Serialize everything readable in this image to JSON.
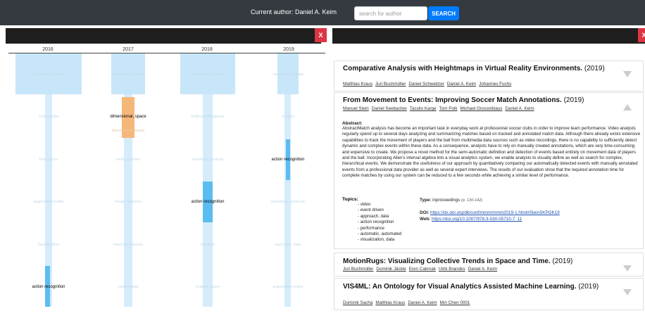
{
  "header": {
    "author_label": "Current author: Daniel A. Keim",
    "search_placeholder": "search for author",
    "search_button": "SEARCH"
  },
  "left_panel": {
    "close_label": "X"
  },
  "right_panel": {
    "close_label": "X"
  },
  "timeline": {
    "years": [
      "2016",
      "2017",
      "2018",
      "2019"
    ],
    "rows": [
      [
        "visualization, data",
        "visualization, data",
        "visualization, data",
        "visualization, data"
      ],
      [
        "multi-modal",
        "dimensional, space",
        "artificial intelligence",
        "models"
      ],
      [
        "time series",
        "entity, entities",
        "sensitivity analysis",
        "action recognition"
      ],
      [
        "augmented reality",
        "image, features",
        "action recognition",
        "animation, synthesis"
      ],
      [
        "classification",
        "machine learning",
        "big data",
        "approach, data"
      ],
      [
        "action recognition",
        "multi-modal",
        "chapter, paper",
        "augmented reality"
      ]
    ],
    "sub_label": "dimensional, space"
  },
  "papers": [
    {
      "title": "Comparative Analysis with Heightmaps in Virtual Reality Environments.",
      "year": "(2019)",
      "authors": [
        "Matthias Kraus",
        "Juri Buchmüller",
        "Daniel Schweitzer",
        "Daniel A. Keim",
        "Johannes Fuchs"
      ]
    },
    {
      "title": "From Movement to Events: Improving Soccer Match Annotations.",
      "year": "(2019)",
      "authors": [
        "Manuel Stein",
        "Daniel Seebacher",
        "Tassilo Karge",
        "Tom Polk",
        "Michael Grossniklaus",
        "Daniel A. Keim"
      ],
      "abstract_label": "Abstract:",
      "abstract": "AbstractMatch analysis has become an important task in everyday work at professional soccer clubs in order to improve team performance. Video analysts regularly spend up to several days analyzing and summarizing matches based on tracked and annotated match data. Although there already exists extensive capabilities to track the movement of players and the ball from multimedia data sources such as video recordings, there is no capability to sufficiently detect dynamic and complex events within these data. As a consequence, analysts have to rely on manually created annotations, which are very time-consuming and expensive to create. We propose a novel method for the semi-automatic definition and detection of events based entirely on movement data of players and the ball. Incorporating Allen's interval algebra into a visual analytics system, we enable analysts to visually define as well as search for complex, hierarchical events. We demonstrate the usefulness of our approach by quantitatively comparing our automatically detected events with manually annotated events from a professional data provider as well as several expert interviews. The results of our evaluation show that the required annotation time for complete matches by using our system can be reduced to a few seconds while achieving a similar level of performance.",
      "topics_label": "Topics:",
      "topics": [
        "- video",
        "- event driven",
        "- approach, data",
        "- action recognition",
        "- performance",
        "- automatic, automated",
        "- visualization, data"
      ],
      "type_label": "Type:",
      "type": "inproceedings",
      "pages": "(p. 130-142)",
      "doi_label": "DOI:",
      "doi": "https://dx.doi.org/db/conf/mmm/mmm2019-1.html#SteinSKPGK19",
      "web_label": "Web:",
      "web": "https://doi.org/10.1007/978-3-030-05710-7_11"
    },
    {
      "title": "MotionRugs: Visualizing Collective Trends in Space and Time.",
      "year": "(2019)",
      "authors": [
        "Juri Buchmüller",
        "Dominik Jäckle",
        "Eren Cakmak",
        "Ulrik Brandes",
        "Daniel A. Keim"
      ]
    },
    {
      "title": "VIS4ML: An Ontology for Visual Analytics Assisted Machine Learning.",
      "year": "(2019)",
      "authors": [
        "Dominik Sacha",
        "Matthias Kraus",
        "Daniel A. Keim",
        "Min Chen 0001"
      ]
    }
  ],
  "colors": {
    "header_bg": "#343a40",
    "accent": "#007bff",
    "close": "#dc3545",
    "cell_light": "#c8e6f9",
    "cell_strong": "#5bbcef",
    "cell_orange": "#f5b87a"
  }
}
